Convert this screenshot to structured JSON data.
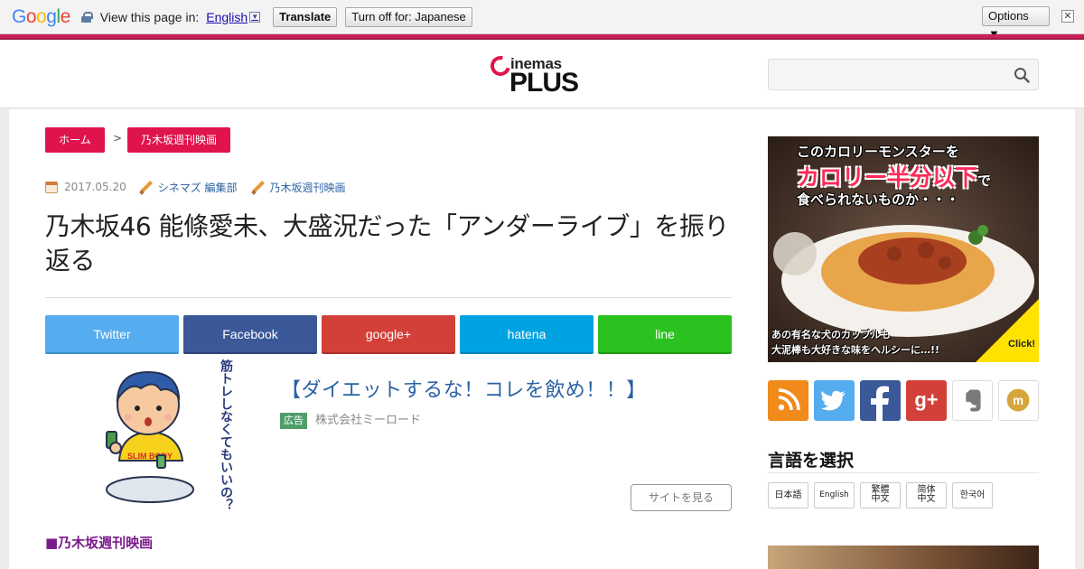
{
  "translate_bar": {
    "google_logo": [
      "G",
      "o",
      "o",
      "g",
      "l",
      "e"
    ],
    "view_label": "View this page in:",
    "language": "English",
    "translate_label": "Translate",
    "turn_off_label": "Turn off for: Japanese",
    "options_label": "Options ▼",
    "close_label": "✕"
  },
  "header": {
    "logo_top": "inemas",
    "logo_bottom": "PLUS",
    "search_placeholder": ""
  },
  "breadcrumb": {
    "home": "ホーム",
    "separator": ">",
    "category": "乃木坂週刊映画"
  },
  "article": {
    "date": "2017.05.20",
    "author": "シネマズ 編集部",
    "category": "乃木坂週刊映画",
    "title": "乃木坂46 能條愛未、大盛況だった「アンダーライブ」を振り返る"
  },
  "share": {
    "twitter": "Twitter",
    "facebook": "Facebook",
    "google": "google+",
    "hatena": "hatena",
    "line": "line"
  },
  "ad": {
    "title": "【ダイエットするな！コレを飲め！！】",
    "badge": "広告",
    "company": "株式会社ミーロード",
    "button": "サイトを見る",
    "illustration_text": "筋トレしなくてもいいの？",
    "shirt_text": "SLIM BODY"
  },
  "section_heading": "■乃木坂週刊映画",
  "sidebar": {
    "banner": {
      "line1": "このカロリーモンスターを",
      "line2": "カロリー半分以下",
      "line2_suffix": "で",
      "line3": "食べられないものか・・・",
      "bottom1": "あの有名な犬のカップルも",
      "bottom2": "大泥棒も大好きな味をヘルシーに…!!",
      "click": "Click!"
    },
    "social": {
      "googleplus_text": "g+",
      "mixi_text": "m"
    },
    "lang_heading": "言語を選択",
    "langs": [
      "日本語",
      "English",
      "繁體\n中文",
      "简体\n中文",
      "한국어"
    ]
  },
  "colors": {
    "accent": "#e0144c",
    "link": "#2a62a6",
    "twitter": "#55acee",
    "facebook": "#3b5998",
    "google": "#d3403a",
    "hatena": "#00a3e1",
    "line": "#2bc11f",
    "rss": "#f08a1a"
  }
}
